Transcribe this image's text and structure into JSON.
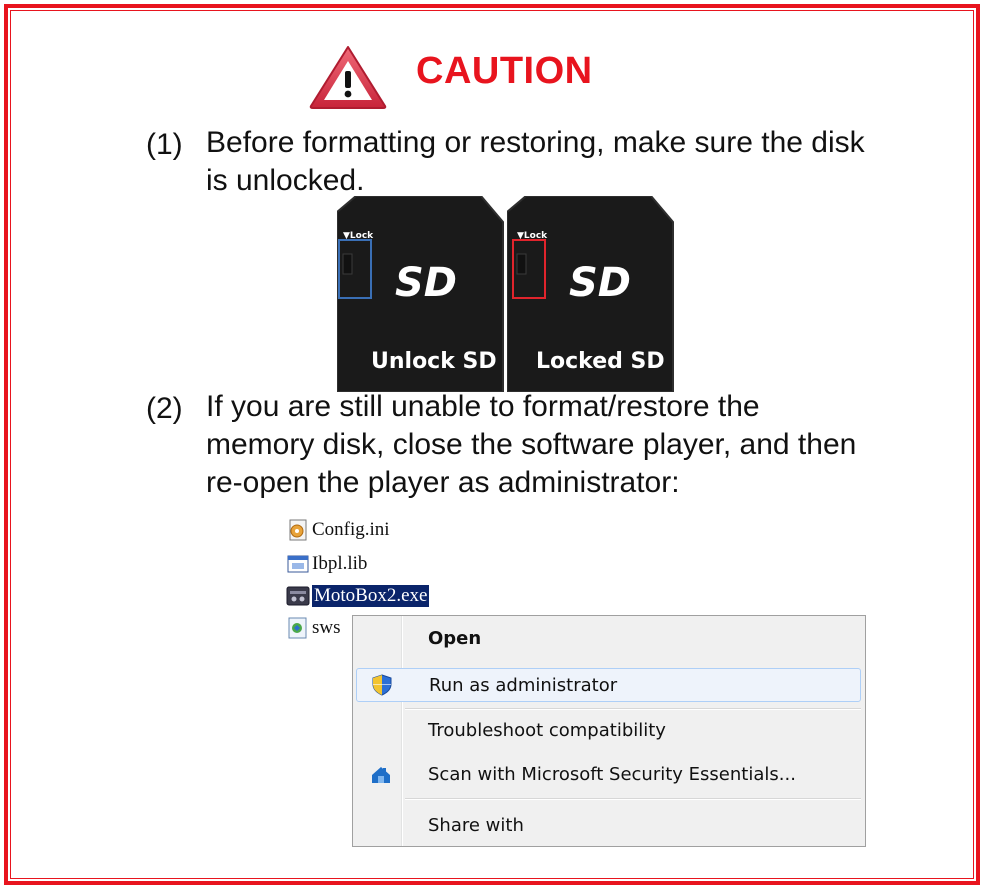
{
  "caution": {
    "title": "CAUTION",
    "icon": "warning-triangle-icon",
    "color": "#e8141e"
  },
  "items": [
    {
      "number": "(1)",
      "lines": [
        "Before formatting or restoring, make sure the disk",
        "is unlocked."
      ]
    },
    {
      "number": "(2)",
      "lines": [
        "If you are still unable to format/restore the",
        "memory disk, close the software player, and then",
        "re-open the player as administrator:"
      ]
    }
  ],
  "sd_cards": [
    {
      "lock_label": "▼Lock",
      "logo": "SD",
      "caption_prefix": "Unlock ",
      "caption_bold": "SD",
      "highlight_color": "#3a6fb5"
    },
    {
      "lock_label": "▼Lock",
      "logo": "SD",
      "caption_prefix": "Locked ",
      "caption_bold": "SD",
      "highlight_color": "#e0242c"
    }
  ],
  "files": [
    {
      "name": "Config.ini",
      "icon": "config-file-icon"
    },
    {
      "name": "Ibpl.lib",
      "icon": "library-file-icon"
    },
    {
      "name": "MotoBox2.exe",
      "icon": "exe-file-icon",
      "selected": true
    },
    {
      "name": "sws",
      "icon": "script-file-icon"
    }
  ],
  "context_menu": {
    "items": [
      {
        "label": "Open",
        "bold": true,
        "icon": ""
      },
      {
        "label": "Run as administrator",
        "icon": "shield-icon",
        "hover": true
      },
      {
        "label": "Troubleshoot compatibility",
        "icon": ""
      },
      {
        "label": "Scan with Microsoft Security Essentials...",
        "icon": "security-essentials-icon"
      },
      {
        "label": "Share with",
        "icon": ""
      }
    ]
  }
}
